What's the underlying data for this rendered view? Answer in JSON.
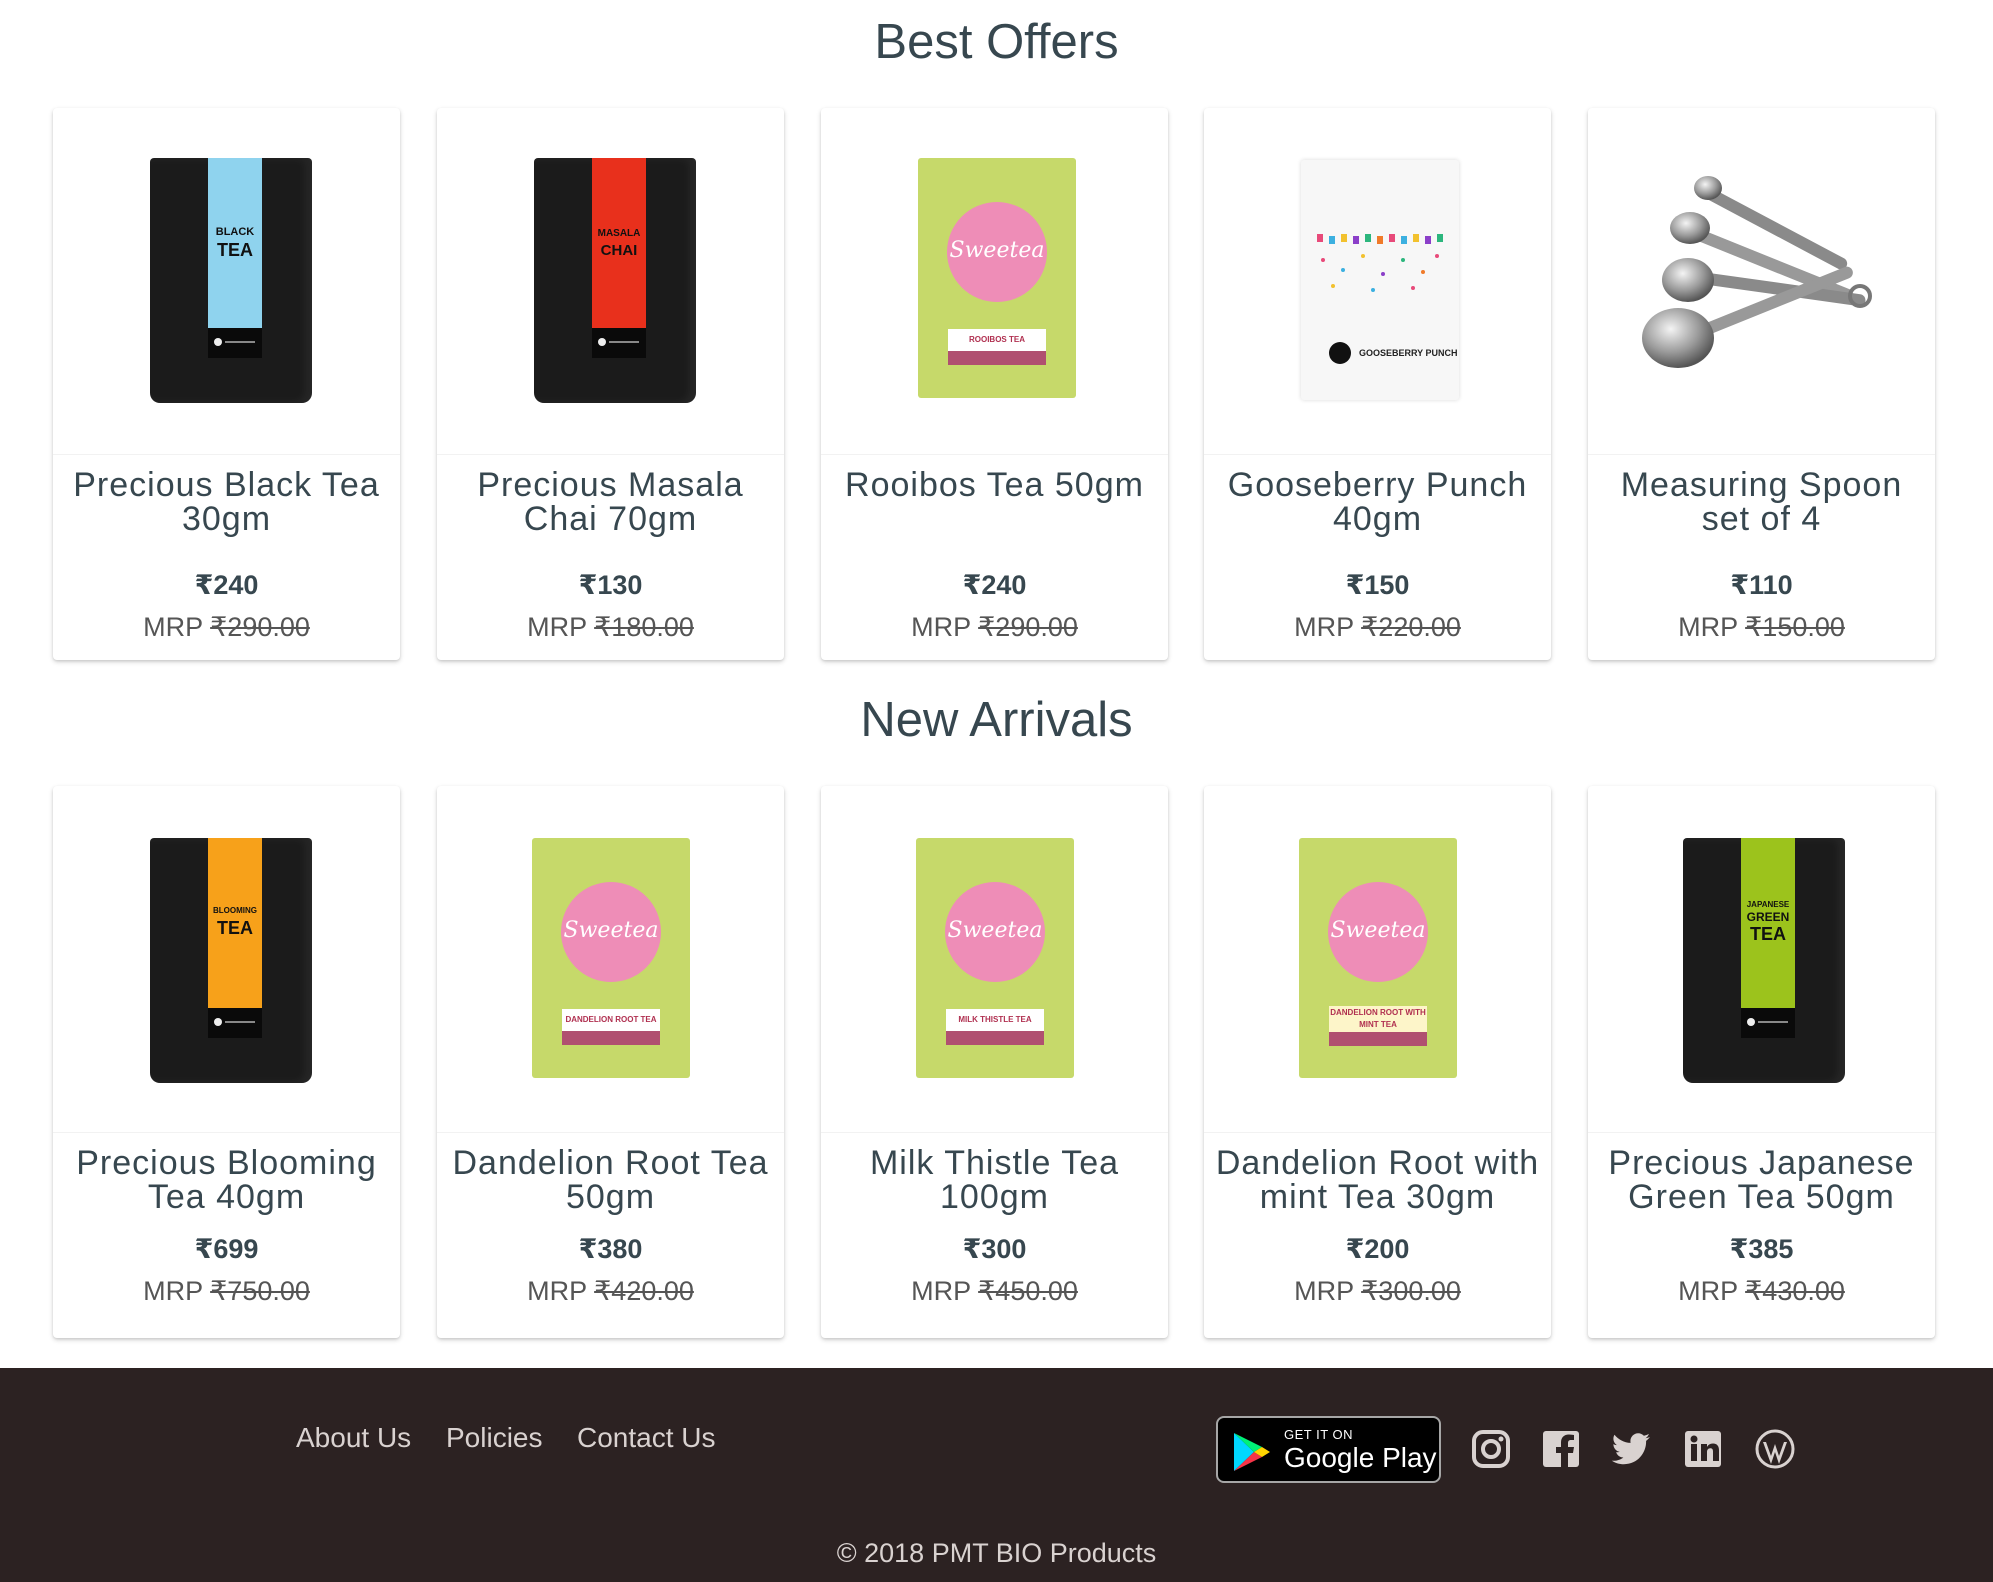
{
  "sections": {
    "best": {
      "title": "Best Offers",
      "products": [
        {
          "name": "Precious Black Tea 30gm",
          "price": "₹240",
          "mrp_label": "MRP",
          "mrp": "₹290.00",
          "pack_lines": [
            "BLACK",
            "TEA"
          ],
          "band_color": "#8fd3ee",
          "brand": "PRECIOUS"
        },
        {
          "name": "Precious Masala Chai 70gm",
          "price": "₹130",
          "mrp_label": "MRP",
          "mrp": "₹180.00",
          "pack_lines": [
            "MASALA",
            "CHAI"
          ],
          "band_color": "#e8301c",
          "brand": "PRECIOUS"
        },
        {
          "name": "Rooibos Tea 50gm",
          "price": "₹240",
          "mrp_label": "MRP",
          "mrp": "₹290.00",
          "pack_logo": "Sweetea",
          "pack_label": "ROOIBOS TEA"
        },
        {
          "name": "Gooseberry Punch 40gm",
          "price": "₹150",
          "mrp_label": "MRP",
          "mrp": "₹220.00",
          "pack_label": "GOOSEBERRY PUNCH"
        },
        {
          "name": "Measuring Spoon set of 4",
          "price": "₹110",
          "mrp_label": "MRP",
          "mrp": "₹150.00"
        }
      ]
    },
    "new": {
      "title": "New Arrivals",
      "products": [
        {
          "name": "Precious Blooming Tea 40gm",
          "price": "₹699",
          "mrp_label": "MRP",
          "mrp": "₹750.00",
          "pack_lines": [
            "BLOOMING",
            "TEA"
          ],
          "band_color": "#f7a11a",
          "brand": "PRECIOUS"
        },
        {
          "name": "Dandelion Root Tea 50gm",
          "price": "₹380",
          "mrp_label": "MRP",
          "mrp": "₹420.00",
          "pack_logo": "Sweetea",
          "pack_label": "DANDELION ROOT TEA"
        },
        {
          "name": "Milk Thistle Tea 100gm",
          "price": "₹300",
          "mrp_label": "MRP",
          "mrp": "₹450.00",
          "pack_logo": "Sweetea",
          "pack_label": "MILK THISTLE TEA"
        },
        {
          "name": "Dandelion Root with mint Tea 30gm",
          "price": "₹200",
          "mrp_label": "MRP",
          "mrp": "₹300.00",
          "pack_logo": "Sweetea",
          "pack_label": "DANDELION ROOT WITH MINT TEA"
        },
        {
          "name": "Precious Japanese Green Tea 50gm",
          "price": "₹385",
          "mrp_label": "MRP",
          "mrp": "₹430.00",
          "pack_lines": [
            "JAPANESE",
            "GREEN",
            "TEA"
          ],
          "band_color": "#9cc31c",
          "brand": "PRECIOUS"
        }
      ]
    }
  },
  "footer": {
    "links": [
      "About Us",
      "Policies",
      "Contact Us"
    ],
    "store_badge": {
      "small": "GET IT ON",
      "big": "Google Play"
    },
    "social_icons": [
      "instagram-icon",
      "facebook-icon",
      "twitter-icon",
      "linkedin-icon",
      "wordpress-icon"
    ],
    "copyright": "© 2018 PMT BIO Products",
    "bg_color": "#2c2222"
  }
}
